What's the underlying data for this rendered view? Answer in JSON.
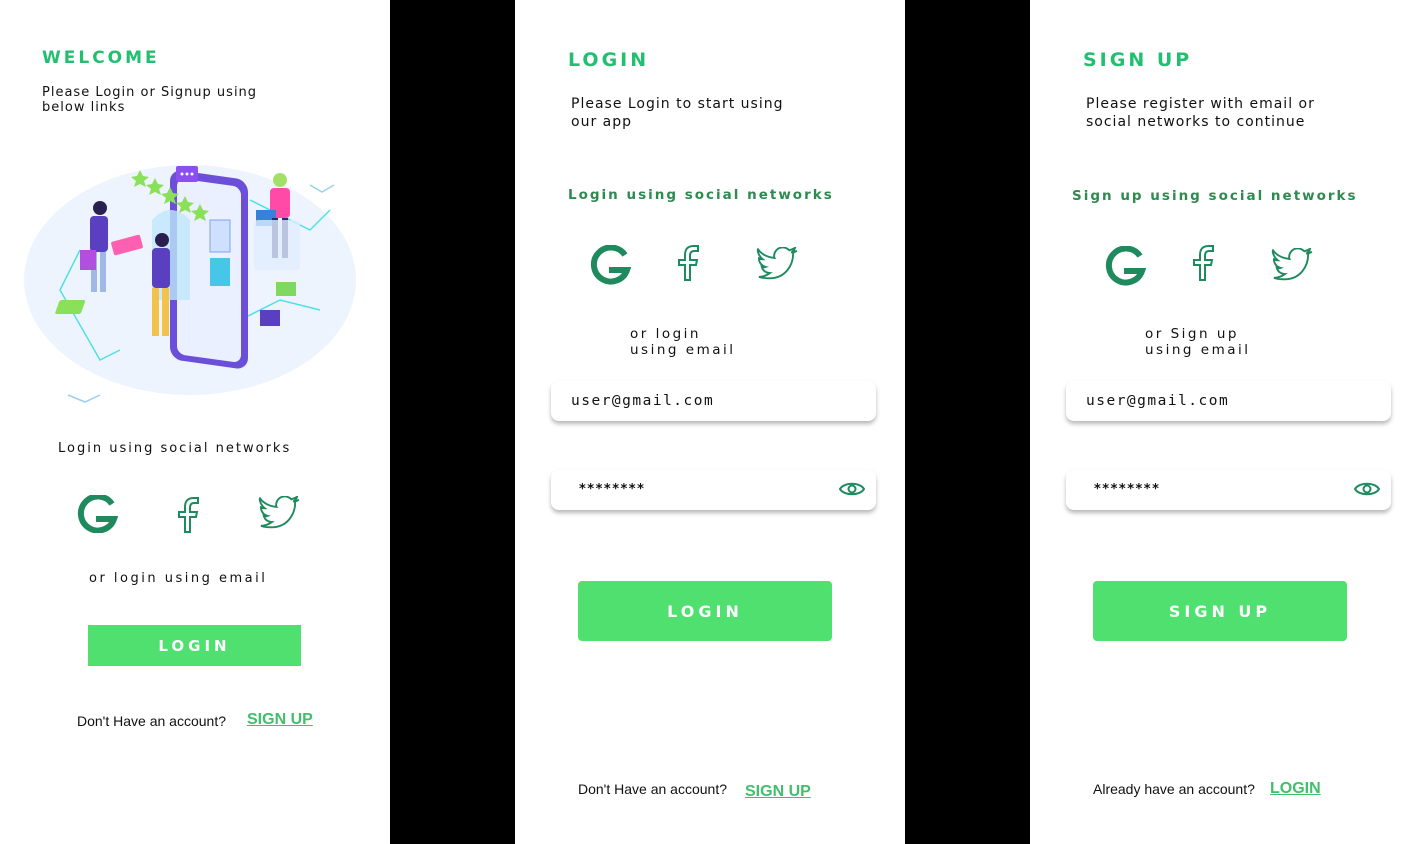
{
  "colors": {
    "accent": "#20c070",
    "button": "#50e070",
    "icon": "#1e8a5e",
    "link": "#3fc06a"
  },
  "welcome": {
    "title": "WELCOME",
    "subtitle_line1": "Please Login or Signup using",
    "subtitle_line2": "below links",
    "social_label": "Login using social networks",
    "or_text": "or login using email",
    "login_button": "LOGIN",
    "no_account_text": "Don't Have an account?",
    "signup_link": "SIGN UP"
  },
  "login": {
    "title": "LOGIN",
    "subtitle_line1": "Please Login to start using",
    "subtitle_line2": "our app",
    "social_label": "Login using social networks",
    "or_line1": "or login",
    "or_line2": "using email",
    "email_value": "user@gmail.com",
    "password_value": "********",
    "login_button": "LOGIN",
    "no_account_text": "Don't Have an account?",
    "signup_link": "SIGN UP"
  },
  "signup": {
    "title": "SIGN UP",
    "subtitle_line1": "Please register with email or",
    "subtitle_line2": "social networks to continue",
    "social_label": "Sign up using social networks",
    "or_line1": "or Sign up",
    "or_line2": "using email",
    "email_value": "user@gmail.com",
    "password_value": "********",
    "signup_button": "SIGN UP",
    "have_account_text": "Already have an account?",
    "login_link": "LOGIN"
  },
  "icons": [
    "google-icon",
    "facebook-icon",
    "twitter-icon",
    "eye-icon"
  ]
}
